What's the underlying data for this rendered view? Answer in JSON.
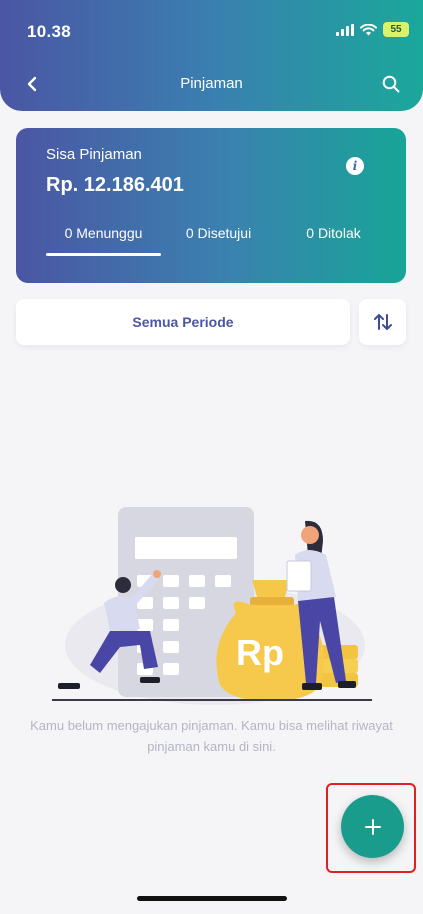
{
  "status_bar": {
    "time": "10.38",
    "battery": "55"
  },
  "header": {
    "title": "Pinjaman",
    "back_icon": "chevron-left-icon",
    "search_icon": "search-icon"
  },
  "loan_card": {
    "label": "Sisa Pinjaman",
    "amount": "Rp. 12.186.401",
    "info_icon": "info-icon",
    "tabs": [
      {
        "label": "0 Menunggu",
        "active": true
      },
      {
        "label": "0 Disetujui",
        "active": false
      },
      {
        "label": "0 Ditolak",
        "active": false
      }
    ]
  },
  "filter": {
    "period_label": "Semua Periode",
    "sort_icon": "sort-arrows-icon"
  },
  "empty_state": {
    "illustration_text": "Rp",
    "message": "Kamu belum mengajukan pinjaman. Kamu bisa melihat riwayat pinjaman kamu di sini."
  },
  "fab": {
    "icon": "plus-icon"
  },
  "colors": {
    "gradient_start": "#4b56a4",
    "gradient_end": "#17a597",
    "fab": "#1a9c8c",
    "highlight": "#e02020"
  }
}
